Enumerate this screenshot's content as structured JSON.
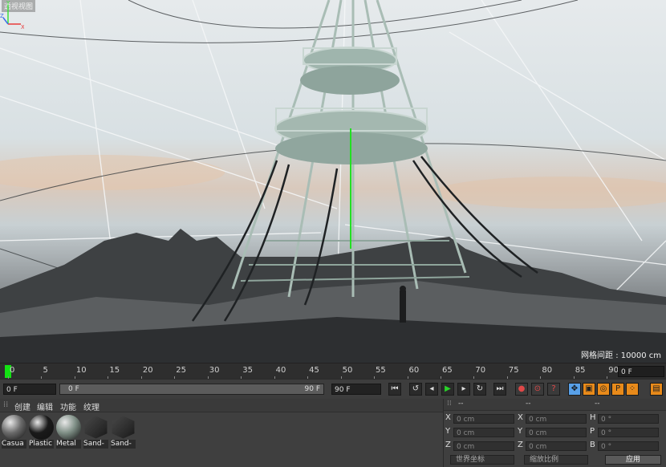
{
  "viewport": {
    "label": "透视视图",
    "grid_spacing": "网格间距 : 10000 cm",
    "axis_labels": {
      "x": "X",
      "y": "Y",
      "z": "Z"
    }
  },
  "timeline": {
    "ticks": [
      "0",
      "5",
      "10",
      "15",
      "20",
      "25",
      "30",
      "35",
      "40",
      "45",
      "50",
      "55",
      "60",
      "65",
      "70",
      "75",
      "80",
      "85",
      "90"
    ],
    "end_field": "0 F"
  },
  "transport": {
    "current_frame": "0 F",
    "range_start": "0 F",
    "range_end": "90 F",
    "max_frame": "90 F",
    "buttons": [
      "go-start",
      "prev-key",
      "prev-frame",
      "play",
      "next-frame",
      "next-key",
      "go-end",
      "record-key",
      "auto-key",
      "help",
      "move",
      "scale",
      "rotate",
      "param",
      "grid"
    ]
  },
  "materials": {
    "menu": [
      "创建",
      "编辑",
      "功能",
      "纹理"
    ],
    "items": [
      {
        "name": "Casua",
        "color": "#6b6b6b"
      },
      {
        "name": "Plastic",
        "color": "#1a1a1a"
      },
      {
        "name": "Metal",
        "color": "#7f8f86"
      },
      {
        "name": "Sand-",
        "color": "#2c2c2c"
      },
      {
        "name": "Sand-",
        "color": "#2c2c2c"
      }
    ]
  },
  "coordinates": {
    "headers": [
      "--",
      "--",
      "--"
    ],
    "rows": [
      {
        "a_label": "X",
        "a_value": "0 cm",
        "b_label": "X",
        "b_value": "0 cm",
        "c_label": "H",
        "c_value": "0 °"
      },
      {
        "a_label": "Y",
        "a_value": "0 cm",
        "b_label": "Y",
        "b_value": "0 cm",
        "c_label": "P",
        "c_value": "0 °"
      },
      {
        "a_label": "Z",
        "a_value": "0 cm",
        "b_label": "Z",
        "b_value": "0 cm",
        "c_label": "B",
        "c_value": "0 °"
      }
    ],
    "mode_select": "世界坐标",
    "scale_select": "缩放比例",
    "apply": "应用"
  }
}
